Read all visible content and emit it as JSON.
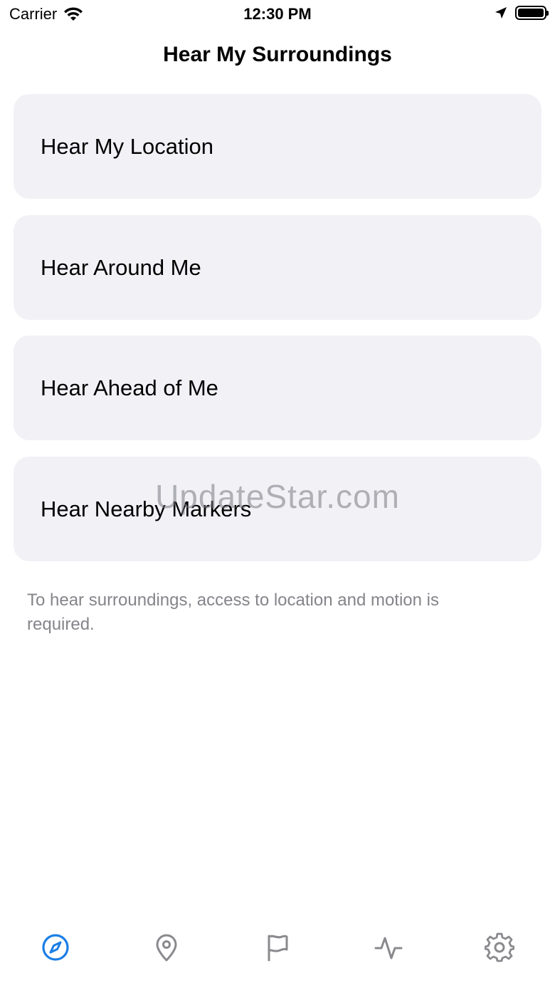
{
  "status_bar": {
    "carrier": "Carrier",
    "time": "12:30 PM",
    "icons": [
      "wifi-icon",
      "location-arrow-icon",
      "battery-icon"
    ]
  },
  "header": {
    "title": "Hear My Surroundings"
  },
  "actions": [
    {
      "label": "Hear My Location"
    },
    {
      "label": "Hear Around Me"
    },
    {
      "label": "Hear Ahead of Me"
    },
    {
      "label": "Hear Nearby Markers"
    }
  ],
  "note": "To hear surroundings, access to location and motion is required.",
  "watermark": "UpdateStar.com",
  "tab_bar": {
    "tabs": [
      {
        "icon": "compass-icon",
        "selected": true
      },
      {
        "icon": "map-pin-icon",
        "selected": false
      },
      {
        "icon": "flag-icon",
        "selected": false
      },
      {
        "icon": "activity-icon",
        "selected": false
      },
      {
        "icon": "gear-icon",
        "selected": false
      }
    ],
    "accent_color": "#1a7ee6",
    "inactive_color": "#8a8a8e"
  }
}
